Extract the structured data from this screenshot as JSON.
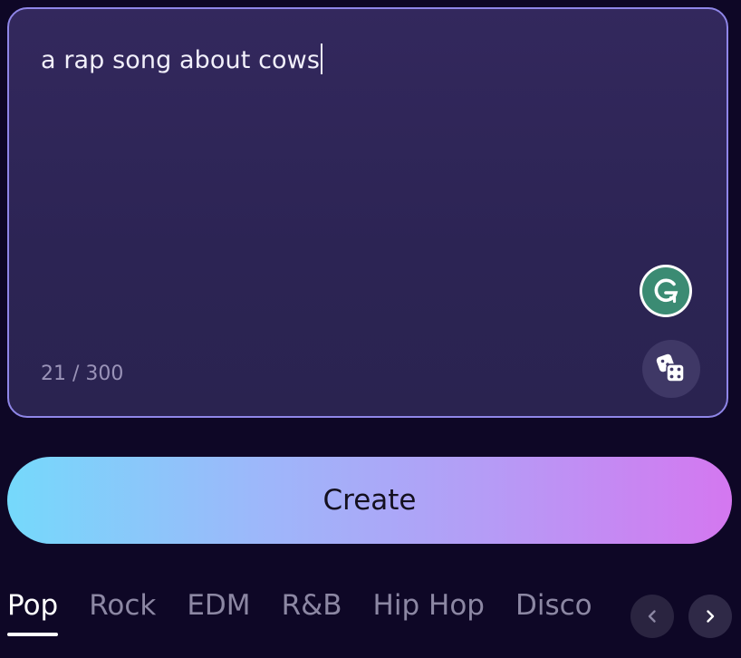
{
  "prompt": {
    "text": "a rap song about cows",
    "char_count": "21 / 300"
  },
  "icons": {
    "grammarly": "grammarly-icon",
    "dice": "dice-icon",
    "prev": "chevron-left-icon",
    "next": "chevron-right-icon"
  },
  "create": {
    "label": "Create"
  },
  "genres": {
    "tabs": [
      "Pop",
      "Rock",
      "EDM",
      "R&B",
      "Hip Hop",
      "Disco"
    ],
    "active": "Pop"
  },
  "colors": {
    "accent_gradient_start": "#75d9fb",
    "accent_gradient_end": "#d477f0",
    "border": "#8f86e8",
    "background": "#0e0726",
    "grammarly_green": "#3b8b73"
  }
}
